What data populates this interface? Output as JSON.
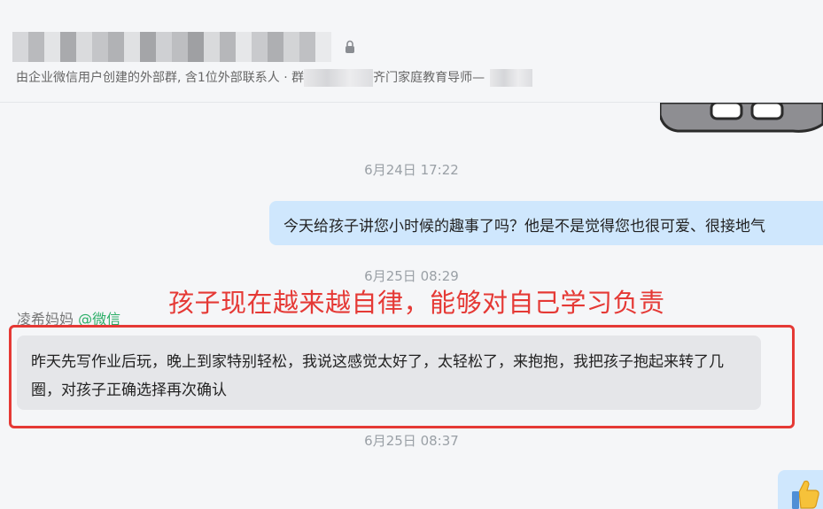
{
  "header": {
    "subtitle_prefix": "由企业微信用户创建的外部群, 含1位外部联系人 · 群",
    "subtitle_suffix": "齐门家庭教育导师—"
  },
  "timestamps": [
    "6月24日 17:22",
    "6月25日 08:29",
    "6月25日 08:37"
  ],
  "messages": {
    "outgoing_1": "今天给孩子讲您小时候的趣事了吗？他是不是觉得您也很可爱、很接地气",
    "incoming_1": {
      "sender_name": "凌希妈妈",
      "sender_source": "@微信",
      "text": "昨天先写作业后玩，晚上到家特别轻松，我说这感觉太好了，太轻松了，来抱抱，我把孩子抱起来转了几圈，对孩子正确选择再次确认"
    }
  },
  "annotation": {
    "title": "孩子现在越来越自律，能够对自己学习负责",
    "color": "#e53935"
  },
  "colors": {
    "outgoing_bubble": "#cfe7fd",
    "incoming_bubble": "#e5e6e9",
    "wechat_green": "#2bae67"
  },
  "icons": {
    "group_lock": "lock-icon",
    "sticker_top": "sticker-image",
    "thumbs_up": "thumbs-up-emoji"
  }
}
